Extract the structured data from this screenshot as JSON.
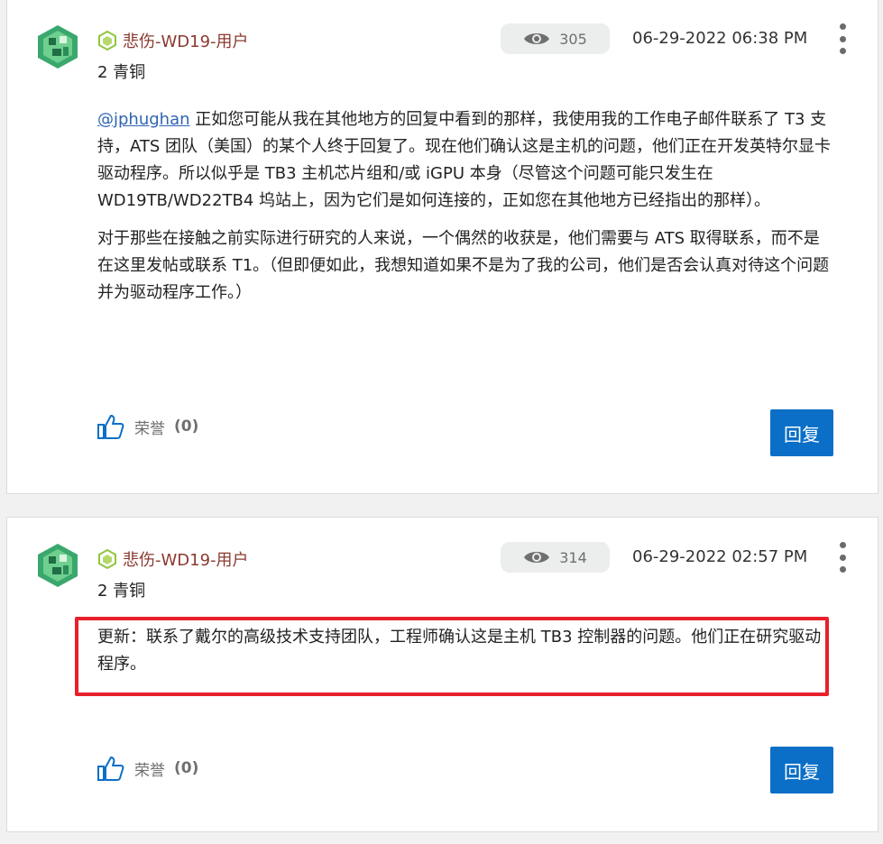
{
  "colors": {
    "author": "#8b3a2f",
    "link": "#2f64b4",
    "reply_button": "#0b6fc7",
    "highlight_border": "#e8202a",
    "views_pill": "#eceded"
  },
  "posts": [
    {
      "author": "悲伤-WD19-用户",
      "rank": "2 青铜",
      "views": "305",
      "date": "06-29-2022 06:38 PM",
      "mention": "@jphughan",
      "paragraph1": " 正如您可能从我在其他地方的回复中看到的那样，我使用我的工作电子邮件联系了 T3 支持，ATS 团队（美国）的某个人终于回复了。现在他们确认这是主机的问题，他们正在开发英特尔显卡驱动程序。所以似乎是 TB3 主机芯片组和/或 iGPU 本身（尽管这个问题可能只发生在 WD19TB/WD22TB4 坞站上，因为它们是如何连接的，正如您在其他地方已经指出的那样）。",
      "paragraph2": "对于那些在接触之前实际进行研究的人来说，一个偶然的收获是，他们需要与 ATS 取得联系，而不是在这里发帖或联系 T1。（但即便如此，我想知道如果不是为了我的公司，他们是否会认真对待这个问题并为驱动程序工作。）",
      "kudos_label": "荣誉",
      "kudos_count": "(0)",
      "reply_label": "回复"
    },
    {
      "author": "悲伤-WD19-用户",
      "rank": "2 青铜",
      "views": "314",
      "date": "06-29-2022 02:57 PM",
      "paragraph1": "更新：联系了戴尔的高级技术支持团队，工程师确认这是主机 TB3 控制器的问题。他们正在研究驱动程序。",
      "kudos_label": "荣誉",
      "kudos_count": "(0)",
      "reply_label": "回复"
    }
  ],
  "icons": {
    "avatar": "green-avatar-icon",
    "rank": "bronze-rank-icon",
    "views": "eye-icon",
    "menu": "kebab-menu-icon",
    "kudos": "thumbs-up-icon"
  }
}
